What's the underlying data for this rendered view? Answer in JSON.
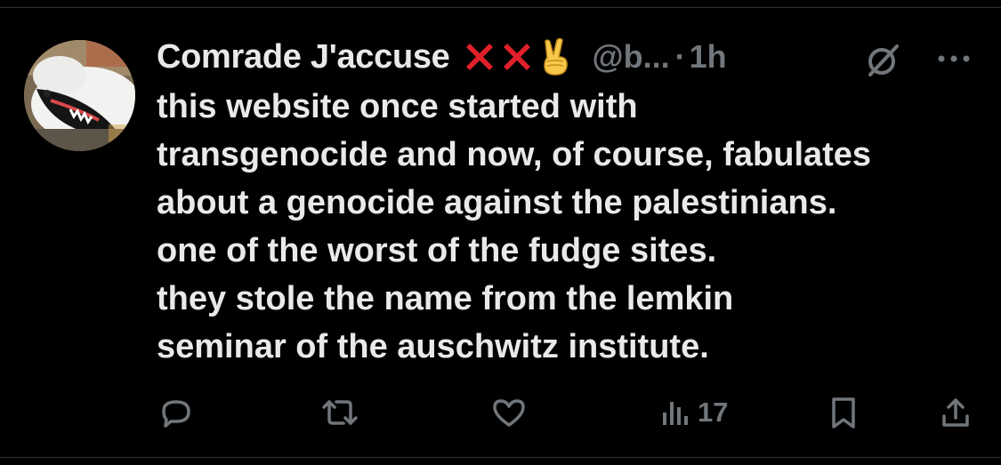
{
  "tweet": {
    "display_name": "Comrade J'accuse",
    "name_emoji": [
      "cross-mark",
      "cross-mark",
      "victory-hand"
    ],
    "handle": "@b...",
    "separator": "·",
    "time": "1h",
    "text_lines": [
      "this website once started with",
      "transgenocide and now, of course, fabulates",
      "about a genocide against the palestinians.",
      "one of the worst of the fudge sites.",
      "they stole the name from the lemkin",
      "seminar of the auschwitz institute."
    ],
    "actions": {
      "reply_icon": "reply-icon",
      "repost_icon": "repost-icon",
      "like_icon": "heart-icon",
      "views_icon": "views-icon",
      "views_count": "17",
      "bookmark_icon": "bookmark-icon",
      "share_icon": "share-icon"
    }
  },
  "colors": {
    "background": "#000000",
    "text": "#e7e9ea",
    "secondary": "#71767b",
    "cross_red": "#e0202a"
  }
}
